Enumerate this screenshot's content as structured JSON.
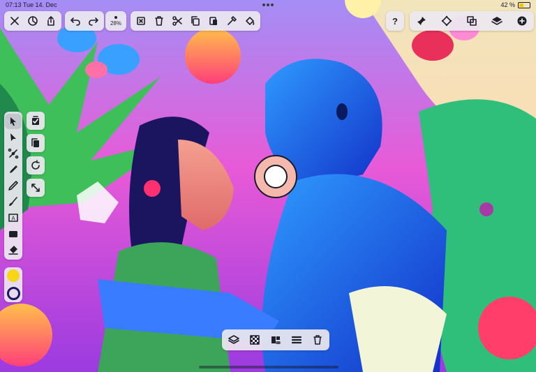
{
  "status_bar": {
    "time": "07:13",
    "date": "Tue 14. Dec",
    "battery": "42 %"
  },
  "top_toolbar": {
    "left_icons": [
      "close-icon",
      "settings-icon",
      "share-icon"
    ],
    "history_icons": [
      "undo-icon",
      "redo-icon"
    ],
    "zoom": "28%",
    "edit_icons": [
      "select-box-icon",
      "trash-icon",
      "scissors-icon",
      "copy-icon",
      "paste-icon",
      "eyedropper-icon",
      "paint-bucket-icon"
    ],
    "help": "?",
    "right_icons": [
      "pin-icon",
      "transform-icon",
      "arrange-icon",
      "layers-icon",
      "add-icon"
    ]
  },
  "left_toolbar": {
    "tools": [
      "pointer-icon",
      "direct-select-icon",
      "node-edit-icon",
      "pen-icon",
      "pencil-icon",
      "brush-icon",
      "text-icon",
      "rectangle-icon",
      "eraser-icon"
    ],
    "active_tool": "pointer-icon",
    "sub_tools": [
      "check-square-icon",
      "duplicate-icon",
      "rotate-icon",
      "resize-icon"
    ],
    "text_tool_label": "A",
    "fill_color": "#f9d51a",
    "stroke_color": "#1a1866"
  },
  "bottom_toolbar": {
    "icons": [
      "layers-stack-icon",
      "checker-icon",
      "align-icon",
      "distribute-icon",
      "delete-icon"
    ]
  },
  "colors": {
    "accent": "#1f1f28",
    "toolbar_bg": "#ece8f0"
  }
}
